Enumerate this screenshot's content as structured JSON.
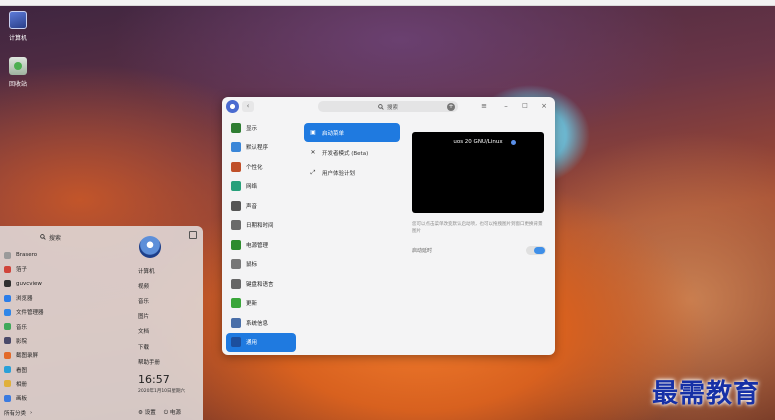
{
  "desktop": {
    "icons": [
      {
        "label": "计算机",
        "icon": "computer-icon"
      },
      {
        "label": "回收站",
        "icon": "trash-icon"
      }
    ]
  },
  "launcher": {
    "search_label": "搜索",
    "apps": [
      {
        "label": "Brasero",
        "color": "#9a9a9a"
      },
      {
        "label": "箔子",
        "color": "#d0443a"
      },
      {
        "label": "guvcview",
        "color": "#2f2f2f"
      },
      {
        "label": "浏览器",
        "color": "#2b7de9"
      },
      {
        "label": "文件管理器",
        "color": "#2f86e8"
      },
      {
        "label": "音乐",
        "color": "#3fa85a"
      },
      {
        "label": "影院",
        "color": "#4a4a6a"
      },
      {
        "label": "截图录屏",
        "color": "#e36a2a"
      },
      {
        "label": "看图",
        "color": "#2aa0d8"
      },
      {
        "label": "相册",
        "color": "#e0b03a"
      },
      {
        "label": "画板",
        "color": "#3b7be0"
      }
    ],
    "all_categories_label": "所有分类",
    "right_items": [
      "计算机",
      "视频",
      "音乐",
      "图片",
      "文档",
      "下载",
      "帮助手册"
    ],
    "clock": "16:57",
    "date": "2020年1月10日星期六",
    "settings_label": "设置",
    "power_label": "电源"
  },
  "settings": {
    "search_placeholder": "搜索",
    "sidebar": [
      {
        "label": "显示",
        "icon": "display-icon",
        "color": "#2e7d32"
      },
      {
        "label": "默认程序",
        "icon": "default-apps-icon",
        "color": "#3a86d8"
      },
      {
        "label": "个性化",
        "icon": "personalization-icon",
        "color": "#c0502a"
      },
      {
        "label": "网络",
        "icon": "network-icon",
        "color": "#27a07a"
      },
      {
        "label": "声音",
        "icon": "sound-icon",
        "color": "#555555"
      },
      {
        "label": "日期和时间",
        "icon": "clock-icon",
        "color": "#6a6a6a"
      },
      {
        "label": "电源管理",
        "icon": "power-management-icon",
        "color": "#2e8b2e"
      },
      {
        "label": "鼠标",
        "icon": "mouse-icon",
        "color": "#777777"
      },
      {
        "label": "键盘和语言",
        "icon": "keyboard-icon",
        "color": "#666666"
      },
      {
        "label": "更新",
        "icon": "update-icon",
        "color": "#3aa63a"
      },
      {
        "label": "系统信息",
        "icon": "system-info-icon",
        "color": "#4a6fa8"
      },
      {
        "label": "通用",
        "icon": "general-icon",
        "color": "#1c4f9e"
      }
    ],
    "active_sidebar": "通用",
    "subnav": [
      {
        "label": "启动菜单",
        "icon": "▣"
      },
      {
        "label": "开发者模式 (Beta)",
        "icon": "✕"
      },
      {
        "label": "用户体验计划",
        "icon": "⤢"
      }
    ],
    "boot_preview_label": "uos 20 GNU/Linux",
    "hint": "您可以点击菜单改变默认启动项，也可以拖拽图片到窗口更换背景图片",
    "boot_animation_label": "启动延时",
    "boot_animation_enabled": true
  },
  "watermark": "最需教育"
}
